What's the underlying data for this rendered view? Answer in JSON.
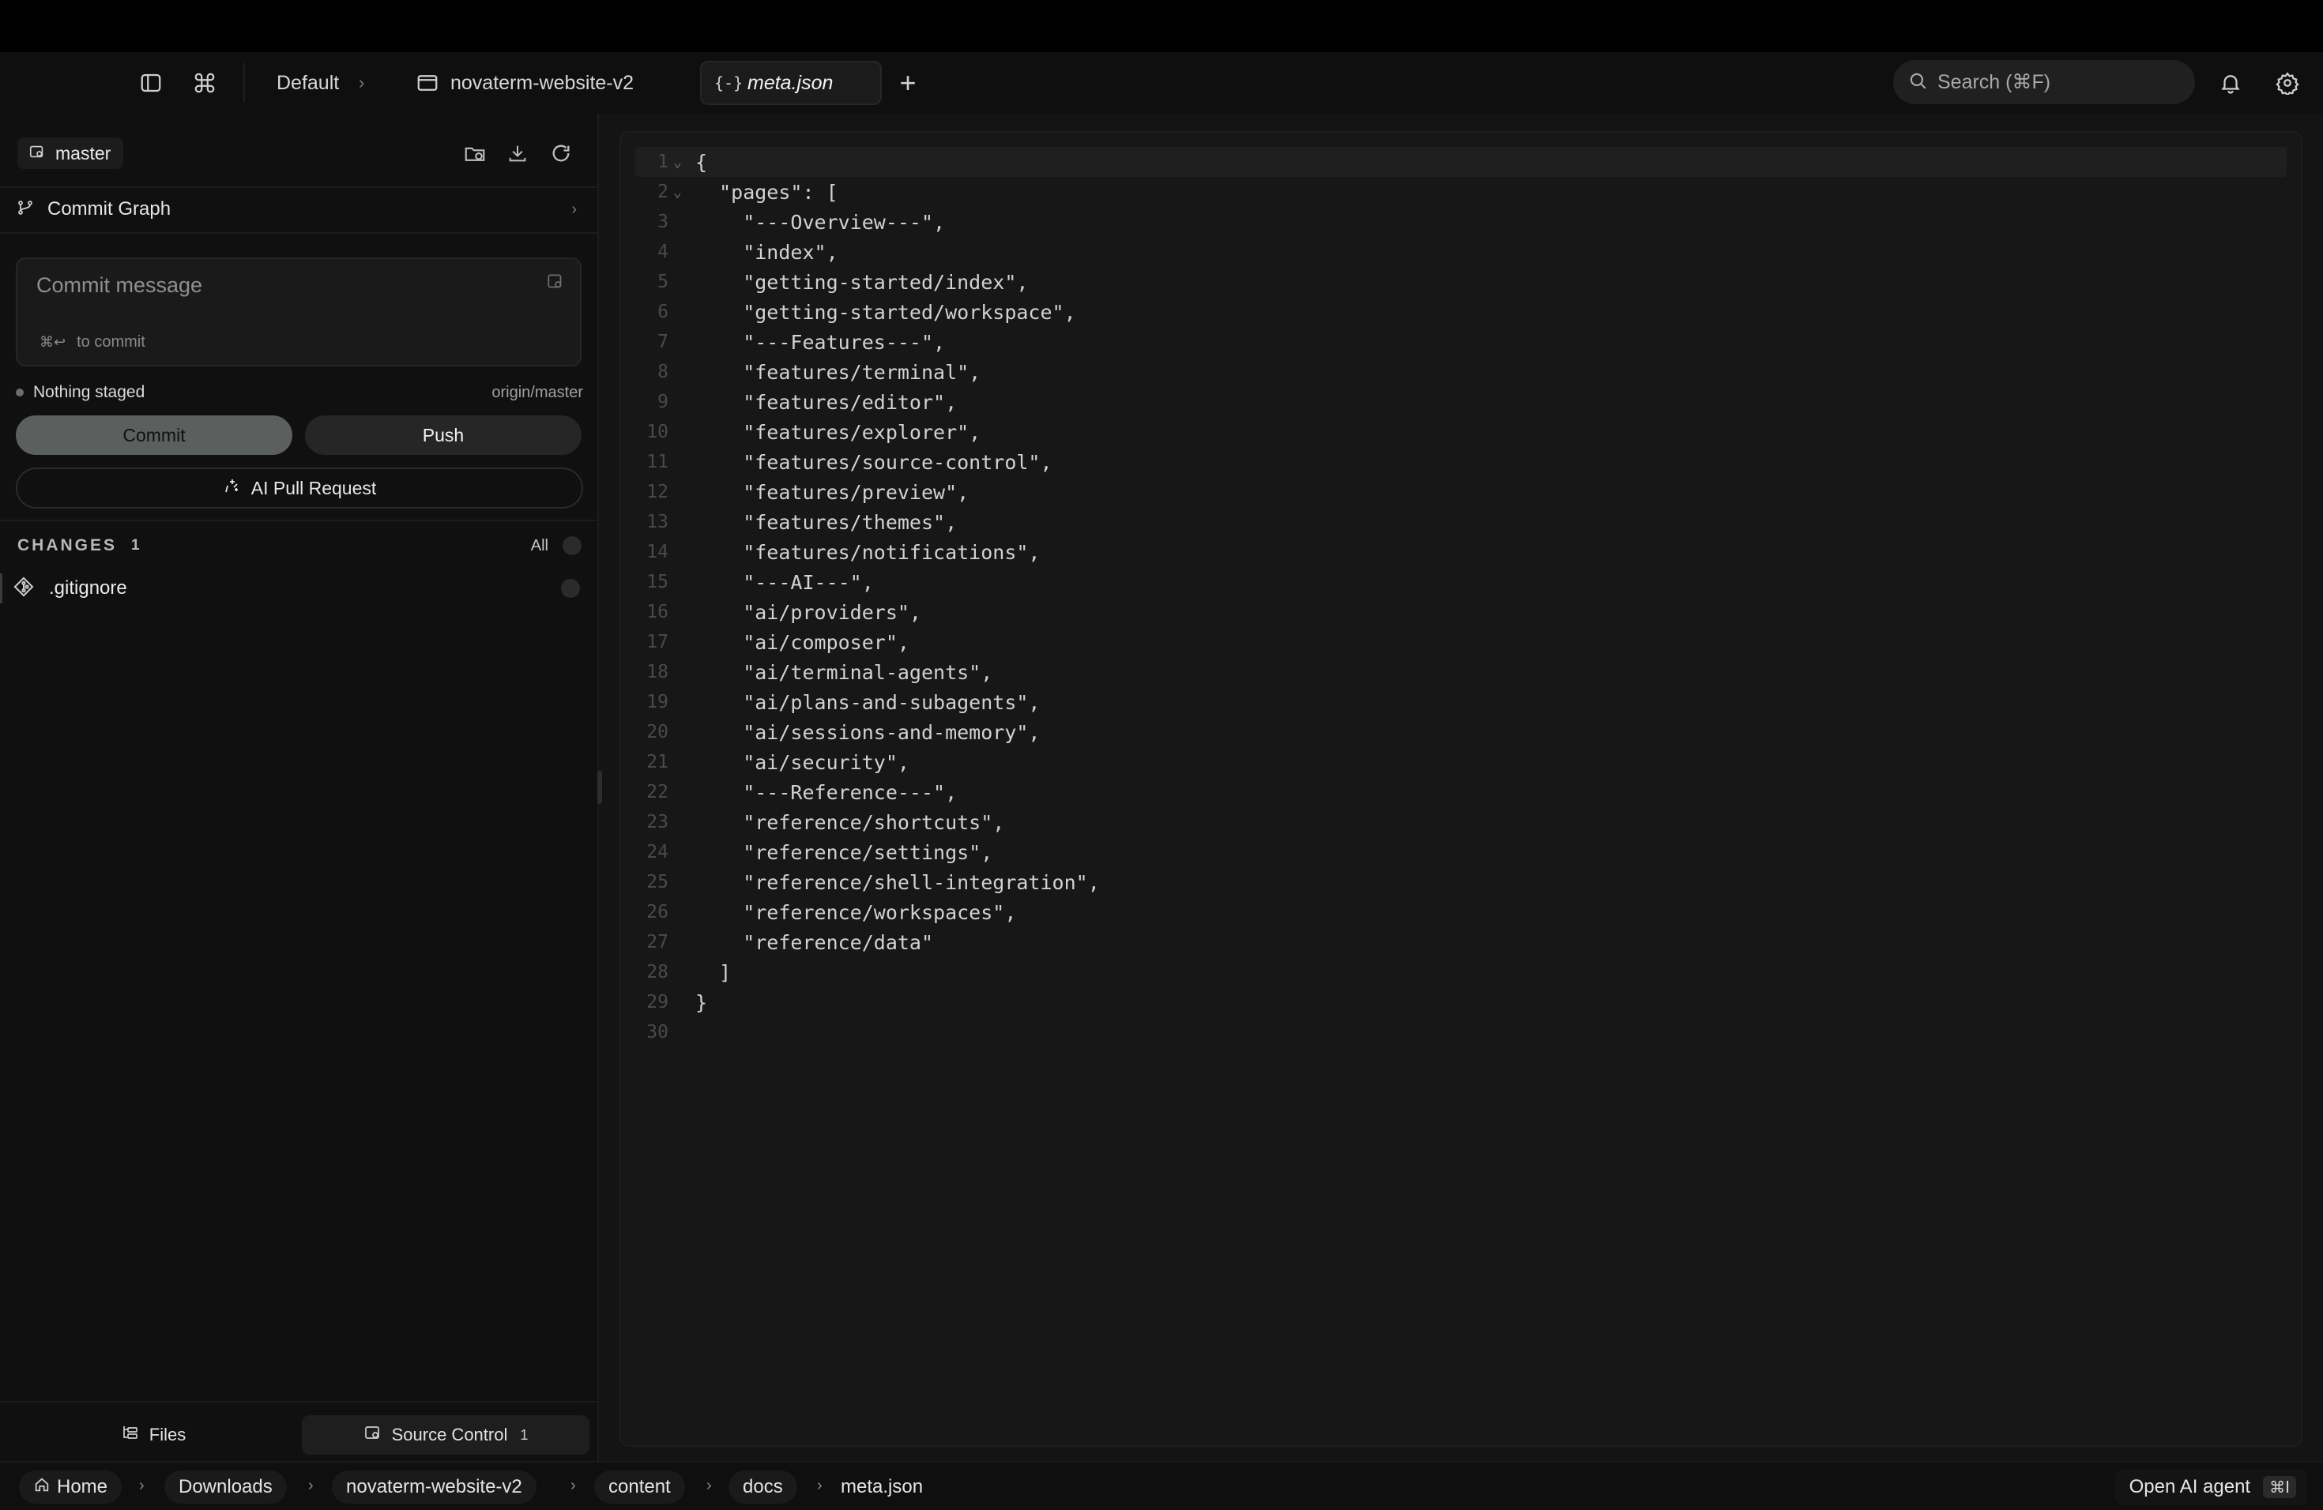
{
  "titlebar": {
    "workspace": "Default",
    "project": "novaterm-website-v2",
    "tab_label": "meta.json",
    "search_placeholder": "Search (⌘F)"
  },
  "sidebar": {
    "branch": "master",
    "commit_graph_label": "Commit Graph",
    "commit_placeholder": "Commit message",
    "commit_hint_keys": "⌘↩",
    "commit_hint": "to commit",
    "status": "Nothing staged",
    "remote": "origin/master",
    "commit_button": "Commit",
    "push_button": "Push",
    "ai_pr_button": "AI Pull Request",
    "changes_title": "CHANGES",
    "changes_count": "1",
    "changes_all": "All",
    "files": [
      ".gitignore"
    ],
    "bottom_tabs": {
      "files": "Files",
      "source_control": "Source Control",
      "source_control_count": "1"
    }
  },
  "editor": {
    "lines": [
      "{",
      "  \"pages\": [",
      "    \"---Overview---\",",
      "    \"index\",",
      "    \"getting-started/index\",",
      "    \"getting-started/workspace\",",
      "    \"---Features---\",",
      "    \"features/terminal\",",
      "    \"features/editor\",",
      "    \"features/explorer\",",
      "    \"features/source-control\",",
      "    \"features/preview\",",
      "    \"features/themes\",",
      "    \"features/notifications\",",
      "    \"---AI---\",",
      "    \"ai/providers\",",
      "    \"ai/composer\",",
      "    \"ai/terminal-agents\",",
      "    \"ai/plans-and-subagents\",",
      "    \"ai/sessions-and-memory\",",
      "    \"ai/security\",",
      "    \"---Reference---\",",
      "    \"reference/shortcuts\",",
      "    \"reference/settings\",",
      "    \"reference/shell-integration\",",
      "    \"reference/workspaces\",",
      "    \"reference/data\"",
      "  ]",
      "}",
      ""
    ]
  },
  "statusbar": {
    "crumbs": [
      "Home",
      "Downloads",
      "novaterm-website-v2",
      "content",
      "docs",
      "meta.json"
    ],
    "agent_label": "Open AI agent",
    "agent_shortcut": "⌘I"
  },
  "icons": {
    "sidebar_toggle": "sidebar-toggle-icon",
    "command": "command-icon",
    "window": "window-icon",
    "json_file": "json-file-icon",
    "plus": "plus-icon",
    "search": "search-icon",
    "bell": "bell-icon",
    "gear": "gear-icon",
    "branch": "branch-icon",
    "folder_add": "folder-add-icon",
    "download": "download-icon",
    "refresh": "refresh-icon",
    "git_graph": "git-graph-icon",
    "sparkle": "sparkle-icon",
    "git_file": "git-file-icon",
    "files": "files-icon",
    "home": "home-icon"
  },
  "colors": {
    "background": "#141414",
    "sidebar": "#101010",
    "editor": "#171717",
    "commit_button": "#5b5f5d"
  }
}
